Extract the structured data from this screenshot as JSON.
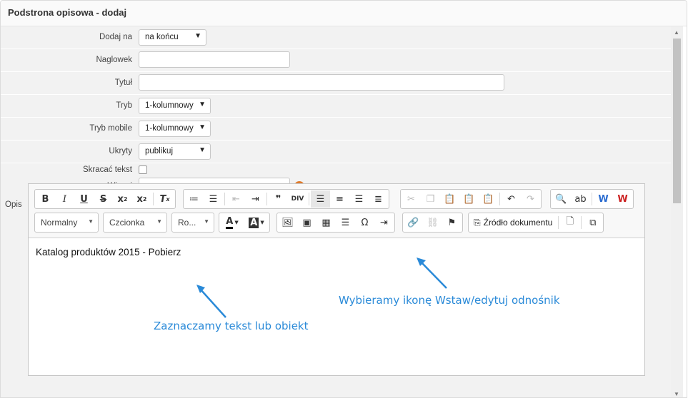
{
  "panel": {
    "title": "Podstrona opisowa - dodaj"
  },
  "form": {
    "dodaj_na": {
      "label": "Dodaj na",
      "value": "na końcu"
    },
    "naglowek": {
      "label": "Naglowek",
      "value": ""
    },
    "tytul": {
      "label": "Tytuł",
      "value": ""
    },
    "tryb": {
      "label": "Tryb",
      "value": "1-kolumnowy"
    },
    "tryb_mobile": {
      "label": "Tryb mobile",
      "value": "1-kolumnowy"
    },
    "ukryty": {
      "label": "Ukryty",
      "value": "publikuj"
    },
    "skracac": {
      "label": "Skracać tekst",
      "checked": false
    },
    "wiecej": {
      "label": "Wiecej",
      "value": ""
    },
    "opis": {
      "label": "Opis"
    }
  },
  "editor": {
    "format_combo": "Normalny",
    "font_combo": "Czcionka",
    "size_combo": "Ro...",
    "source_label": "Źródło dokumentu",
    "content_text": "Katalog produktów 2015 - Pobierz"
  },
  "annotations": {
    "select_text": "Zaznaczamy tekst lub obiekt",
    "choose_icon": "Wybieramy ikonę Wstaw/edytuj odnośnik"
  },
  "colors": {
    "annotation": "#2a8ad8",
    "row_bg": "#f2f2f2"
  }
}
